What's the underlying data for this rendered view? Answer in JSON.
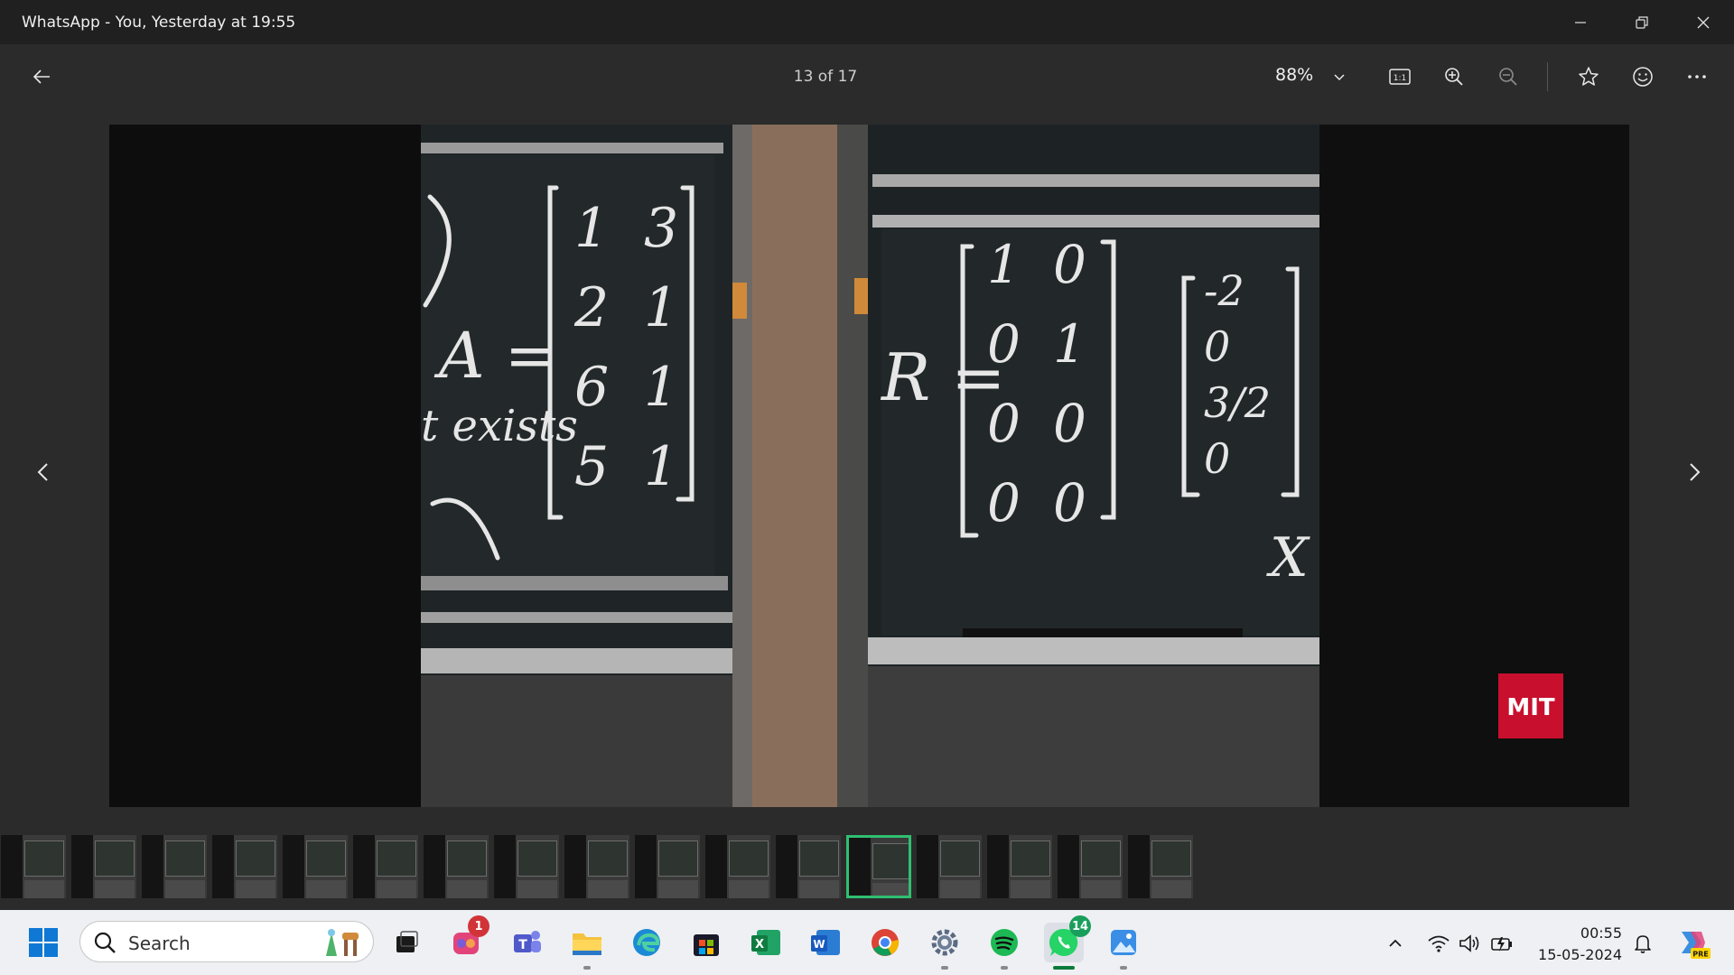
{
  "window": {
    "title": "WhatsApp - You, Yesterday at 19:55"
  },
  "toolbar": {
    "counter": "13 of 17",
    "zoom": "88%"
  },
  "photo": {
    "left_board": {
      "line1": "A =",
      "line2": "t exists",
      "matrix_col1": [
        "1",
        "2",
        "6",
        "5"
      ],
      "matrix_col2": [
        "3",
        "1",
        "1",
        "1"
      ]
    },
    "right_board": {
      "label": "R =",
      "matrix_col1": [
        "1",
        "0",
        "0",
        "0"
      ],
      "matrix_col2": [
        "0",
        "1",
        "0",
        "0"
      ],
      "vector": [
        "-2",
        "0",
        "3/2",
        "0"
      ],
      "var": "X"
    },
    "logo": "MIT"
  },
  "thumbnails": {
    "count": 17,
    "active_index": 13
  },
  "taskbar": {
    "search_label": "Search",
    "copilot_badge": "1",
    "whatsapp_badge": "14",
    "time": "00:55",
    "date": "15-05-2024",
    "copilot_tag": "PRE"
  },
  "colors": {
    "accent": "#2fbf71",
    "mit_red": "#c8102e"
  }
}
